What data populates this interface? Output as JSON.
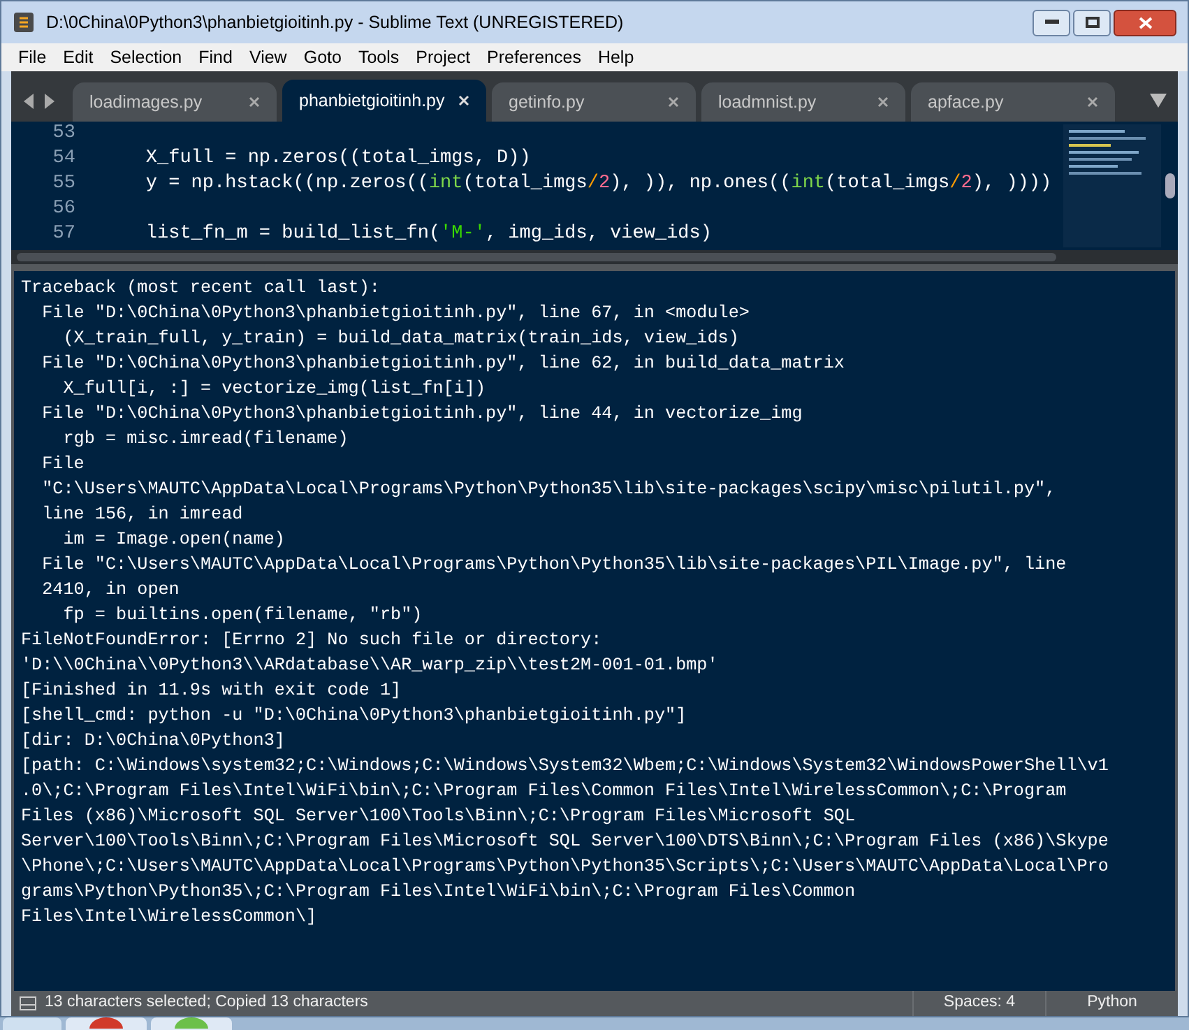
{
  "window": {
    "title": "D:\\0China\\0Python3\\phanbietgioitinh.py - Sublime Text (UNREGISTERED)"
  },
  "menu": [
    "File",
    "Edit",
    "Selection",
    "Find",
    "View",
    "Goto",
    "Tools",
    "Project",
    "Preferences",
    "Help"
  ],
  "tabs": [
    {
      "label": "loadimages.py",
      "selected": false
    },
    {
      "label": "phanbietgioitinh.py",
      "selected": true
    },
    {
      "label": "getinfo.py",
      "selected": false
    },
    {
      "label": "loadmnist.py",
      "selected": false
    },
    {
      "label": "apface.py",
      "selected": false
    }
  ],
  "editor": {
    "lines": [
      {
        "number": "53"
      },
      {
        "number": "54",
        "tokens": [
          {
            "kind": "plain",
            "text": "    X_full = np.zeros(("
          },
          {
            "kind": "plain",
            "text": "total_imgs, D))"
          }
        ]
      },
      {
        "number": "55",
        "tokens": [
          {
            "kind": "plain",
            "text": "    y = np.hstack((np.zeros(("
          },
          {
            "kind": "builtin",
            "text": "int"
          },
          {
            "kind": "plain",
            "text": "(total_imgs"
          },
          {
            "kind": "operator",
            "text": "/"
          },
          {
            "kind": "number",
            "text": "2"
          },
          {
            "kind": "plain",
            "text": "), )), np.ones(("
          },
          {
            "kind": "builtin",
            "text": "int"
          },
          {
            "kind": "plain",
            "text": "(total_imgs"
          },
          {
            "kind": "operator",
            "text": "/"
          },
          {
            "kind": "number",
            "text": "2"
          },
          {
            "kind": "plain",
            "text": "), ))))"
          }
        ]
      },
      {
        "number": "56"
      },
      {
        "number": "57",
        "tokens": [
          {
            "kind": "plain",
            "text": "    list_fn_m = build_list_fn("
          },
          {
            "kind": "string",
            "text": "'M-'"
          },
          {
            "kind": "plain",
            "text": ", img_ids, view_ids)"
          }
        ]
      }
    ]
  },
  "output_lines": [
    "Traceback (most recent call last):",
    "  File \"D:\\0China\\0Python3\\phanbietgioitinh.py\", line 67, in <module>",
    "    (X_train_full, y_train) = build_data_matrix(train_ids, view_ids)",
    "  File \"D:\\0China\\0Python3\\phanbietgioitinh.py\", line 62, in build_data_matrix",
    "    X_full[i, :] = vectorize_img(list_fn[i])",
    "  File \"D:\\0China\\0Python3\\phanbietgioitinh.py\", line 44, in vectorize_img",
    "    rgb = misc.imread(filename)",
    "  File",
    "  \"C:\\Users\\MAUTC\\AppData\\Local\\Programs\\Python\\Python35\\lib\\site-packages\\scipy\\misc\\pilutil.py\",",
    "  line 156, in imread",
    "    im = Image.open(name)",
    "  File \"C:\\Users\\MAUTC\\AppData\\Local\\Programs\\Python\\Python35\\lib\\site-packages\\PIL\\Image.py\", line",
    "  2410, in open",
    "    fp = builtins.open(filename, \"rb\")",
    "FileNotFoundError: [Errno 2] No such file or directory:",
    "'D:\\\\0China\\\\0Python3\\\\ARdatabase\\\\AR_warp_zip\\\\test2M-001-01.bmp'",
    "[Finished in 11.9s with exit code 1]",
    "[shell_cmd: python -u \"D:\\0China\\0Python3\\phanbietgioitinh.py\"]",
    "[dir: D:\\0China\\0Python3]",
    "[path: C:\\Windows\\system32;C:\\Windows;C:\\Windows\\System32\\Wbem;C:\\Windows\\System32\\WindowsPowerShell\\v1",
    ".0\\;C:\\Program Files\\Intel\\WiFi\\bin\\;C:\\Program Files\\Common Files\\Intel\\WirelessCommon\\;C:\\Program",
    "Files (x86)\\Microsoft SQL Server\\100\\Tools\\Binn\\;C:\\Program Files\\Microsoft SQL",
    "Server\\100\\Tools\\Binn\\;C:\\Program Files\\Microsoft SQL Server\\100\\DTS\\Binn\\;C:\\Program Files (x86)\\Skype",
    "\\Phone\\;C:\\Users\\MAUTC\\AppData\\Local\\Programs\\Python\\Python35\\Scripts\\;C:\\Users\\MAUTC\\AppData\\Local\\Pro",
    "grams\\Python\\Python35\\;C:\\Program Files\\Intel\\WiFi\\bin\\;C:\\Program Files\\Common",
    "Files\\Intel\\WirelessCommon\\]"
  ],
  "status_bar": {
    "message": "13 characters selected; Copied 13 characters",
    "indentation": "Spaces: 4",
    "syntax": "Python"
  }
}
